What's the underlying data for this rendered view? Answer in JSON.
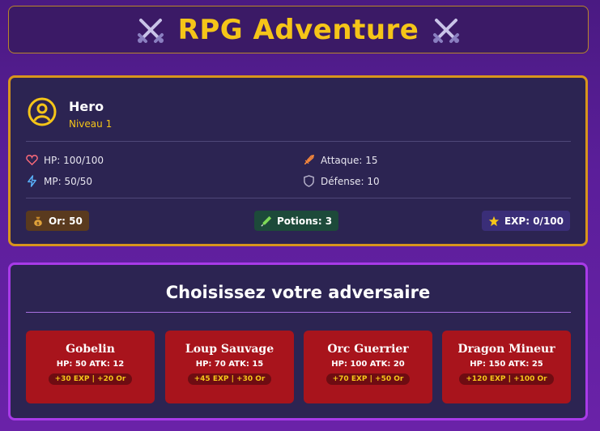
{
  "header": {
    "title": "RPG Adventure",
    "left_icon": "crossed-swords-icon",
    "right_icon": "crossed-swords-icon"
  },
  "hero": {
    "name": "Hero",
    "level": "Niveau 1",
    "avatar_icon": "user-circle-icon",
    "stats": {
      "hp": "HP: 100/100",
      "mp": "MP: 50/50",
      "attack": "Attaque: 15",
      "defense": "Défense: 10"
    },
    "badges": {
      "gold": "Or: 50",
      "potions": "Potions: 3",
      "exp": "EXP: 0/100"
    }
  },
  "enemies": {
    "title": "Choisissez votre adversaire",
    "list": [
      {
        "name": "Gobelin",
        "stats": "HP: 50  ATK: 12",
        "reward": "+30 EXP | +20 Or"
      },
      {
        "name": "Loup Sauvage",
        "stats": "HP: 70  ATK: 15",
        "reward": "+45 EXP | +30 Or"
      },
      {
        "name": "Orc Guerrier",
        "stats": "HP: 100  ATK: 20",
        "reward": "+70 EXP | +50 Or"
      },
      {
        "name": "Dragon Mineur",
        "stats": "HP: 150  ATK: 25",
        "reward": "+120 EXP | +100 Or"
      }
    ]
  },
  "colors": {
    "accent_gold": "#f5c518",
    "hero_border": "#d8951c",
    "enemy_border": "#a83ae8",
    "enemy_card": "#a8141c"
  }
}
